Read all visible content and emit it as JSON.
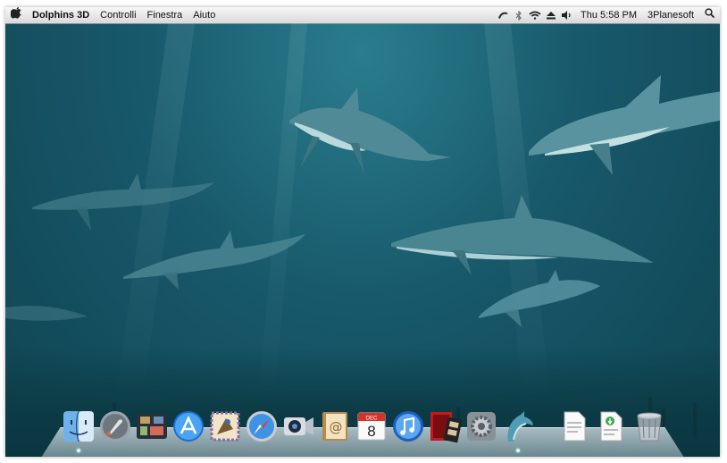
{
  "menubar": {
    "app_name": "Dolphins 3D",
    "menus": [
      "Controlli",
      "Finestra",
      "Aiuto"
    ],
    "clock": "Thu 5:58 PM",
    "user": "3Planesoft",
    "status_icons": [
      "dolphin-status-icon",
      "bluetooth-icon",
      "wifi-icon",
      "eject-icon",
      "volume-icon"
    ]
  },
  "calendar_icon": {
    "month": "DEC",
    "day": "8"
  },
  "dock": {
    "apps": [
      "finder",
      "launchpad",
      "mission-control",
      "app-store",
      "mail",
      "safari",
      "facetime",
      "address-book",
      "ical",
      "itunes",
      "photo-booth",
      "system-preferences",
      "dolphins-3d",
      "document-1",
      "document-2",
      "trash"
    ],
    "running": [
      "finder",
      "dolphins-3d"
    ]
  },
  "colors": {
    "water": "#17586a",
    "dolphin": "#4f8a96",
    "belly": "#b9d9dc"
  }
}
